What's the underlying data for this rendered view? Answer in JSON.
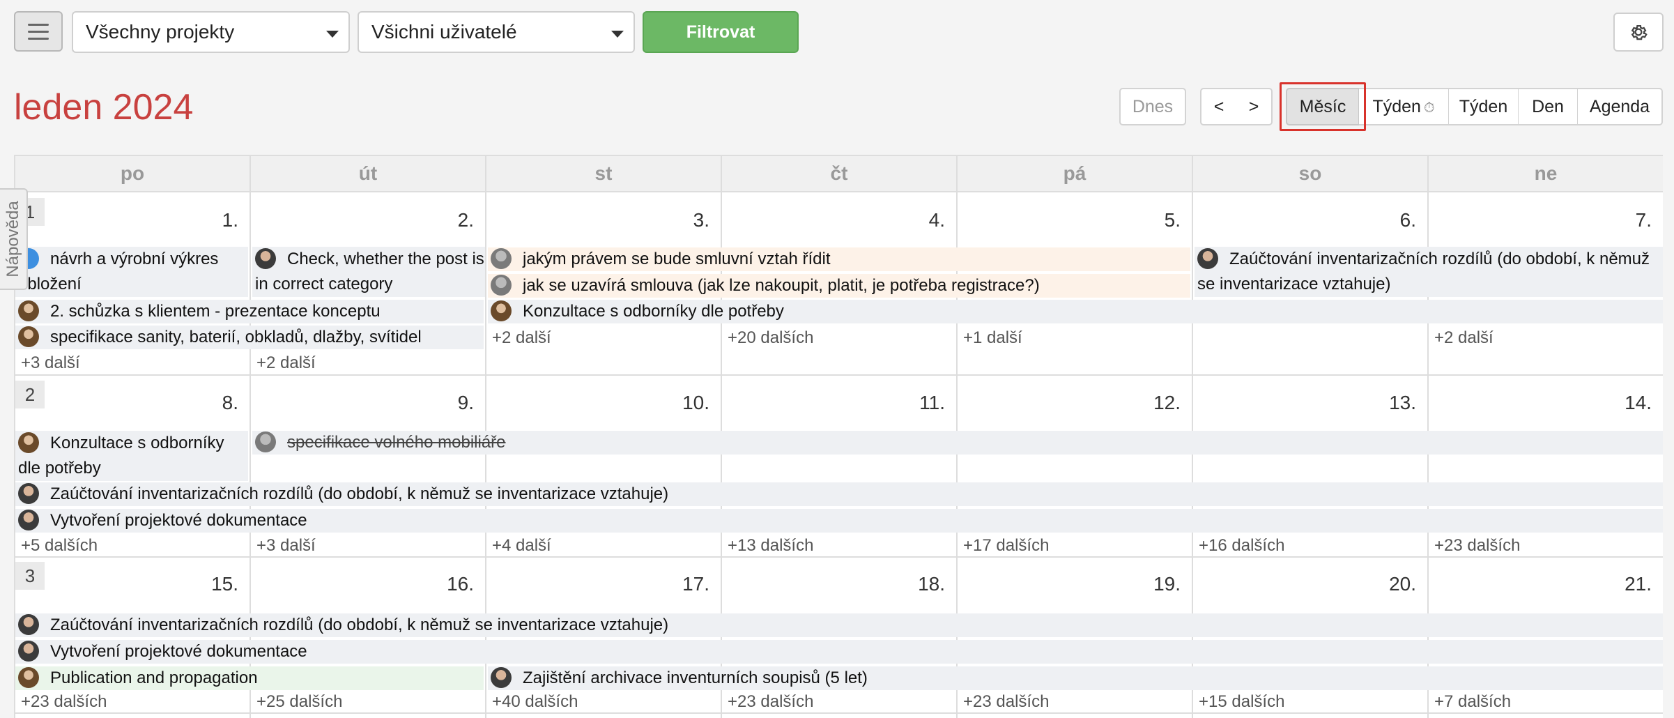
{
  "toolbar": {
    "project_select": "Všechny projekty",
    "user_select": "Všichni uživatelé",
    "filter_label": "Filtrovat"
  },
  "header": {
    "title": "leden 2024",
    "today_label": "Dnes",
    "prev_label": "<",
    "next_label": ">",
    "views": {
      "month": "Měsíc",
      "week_time": "Týden",
      "week": "Týden",
      "day": "Den",
      "agenda": "Agenda"
    },
    "active_view": "Měsíc"
  },
  "help_tab": "Nápověda",
  "calendar": {
    "day_headers": [
      "po",
      "út",
      "st",
      "čt",
      "pá",
      "so",
      "ne"
    ],
    "weeks": [
      {
        "number": "1",
        "days": [
          "1.",
          "2.",
          "3.",
          "4.",
          "5.",
          "6.",
          "7."
        ],
        "events": [
          "návrh a výrobní výkres obložení",
          "Check, whether the post is in correct category",
          "jakým právem se bude smluvní vztah řídit",
          "jak se uzavírá smlouva (jak lze nakoupit, platit, je potřeba registrace?)",
          "Zaúčtování inventarizačních rozdílů (do období, k němuž se inventarizace vztahuje)",
          "2. schůzka s klientem - prezentace konceptu",
          "Konzultace s odborníky dle potřeby",
          "specifikace sanity, baterií, obkladů, dlažby, svítidel"
        ],
        "more": [
          "+3 další",
          "+2 další",
          "+2 další",
          "+20 dalších",
          "+1 další",
          "",
          "+2 další"
        ]
      },
      {
        "number": "2",
        "days": [
          "8.",
          "9.",
          "10.",
          "11.",
          "12.",
          "13.",
          "14."
        ],
        "events": [
          "Konzultace s odborníky dle potřeby",
          "specifikace volného mobiliáře",
          "Zaúčtování inventarizačních rozdílů (do období, k němuž se inventarizace vztahuje)",
          "Vytvoření projektové dokumentace"
        ],
        "more": [
          "+5 dalších",
          "+3 další",
          "+4 další",
          "+13 dalších",
          "+17 dalších",
          "+16 dalších",
          "+23 dalších"
        ]
      },
      {
        "number": "3",
        "days": [
          "15.",
          "16.",
          "17.",
          "18.",
          "19.",
          "20.",
          "21."
        ],
        "events": [
          "Zaúčtování inventarizačních rozdílů (do období, k němuž se inventarizace vztahuje)",
          "Vytvoření projektové dokumentace",
          "Publication and propagation",
          "Zajištění archivace inventurních soupisů (5 let)"
        ],
        "more": [
          "+23 dalších",
          "+25 dalších",
          "+40 dalších",
          "+23 dalších",
          "+23 dalších",
          "+15 dalších",
          "+7 dalších"
        ]
      }
    ]
  }
}
